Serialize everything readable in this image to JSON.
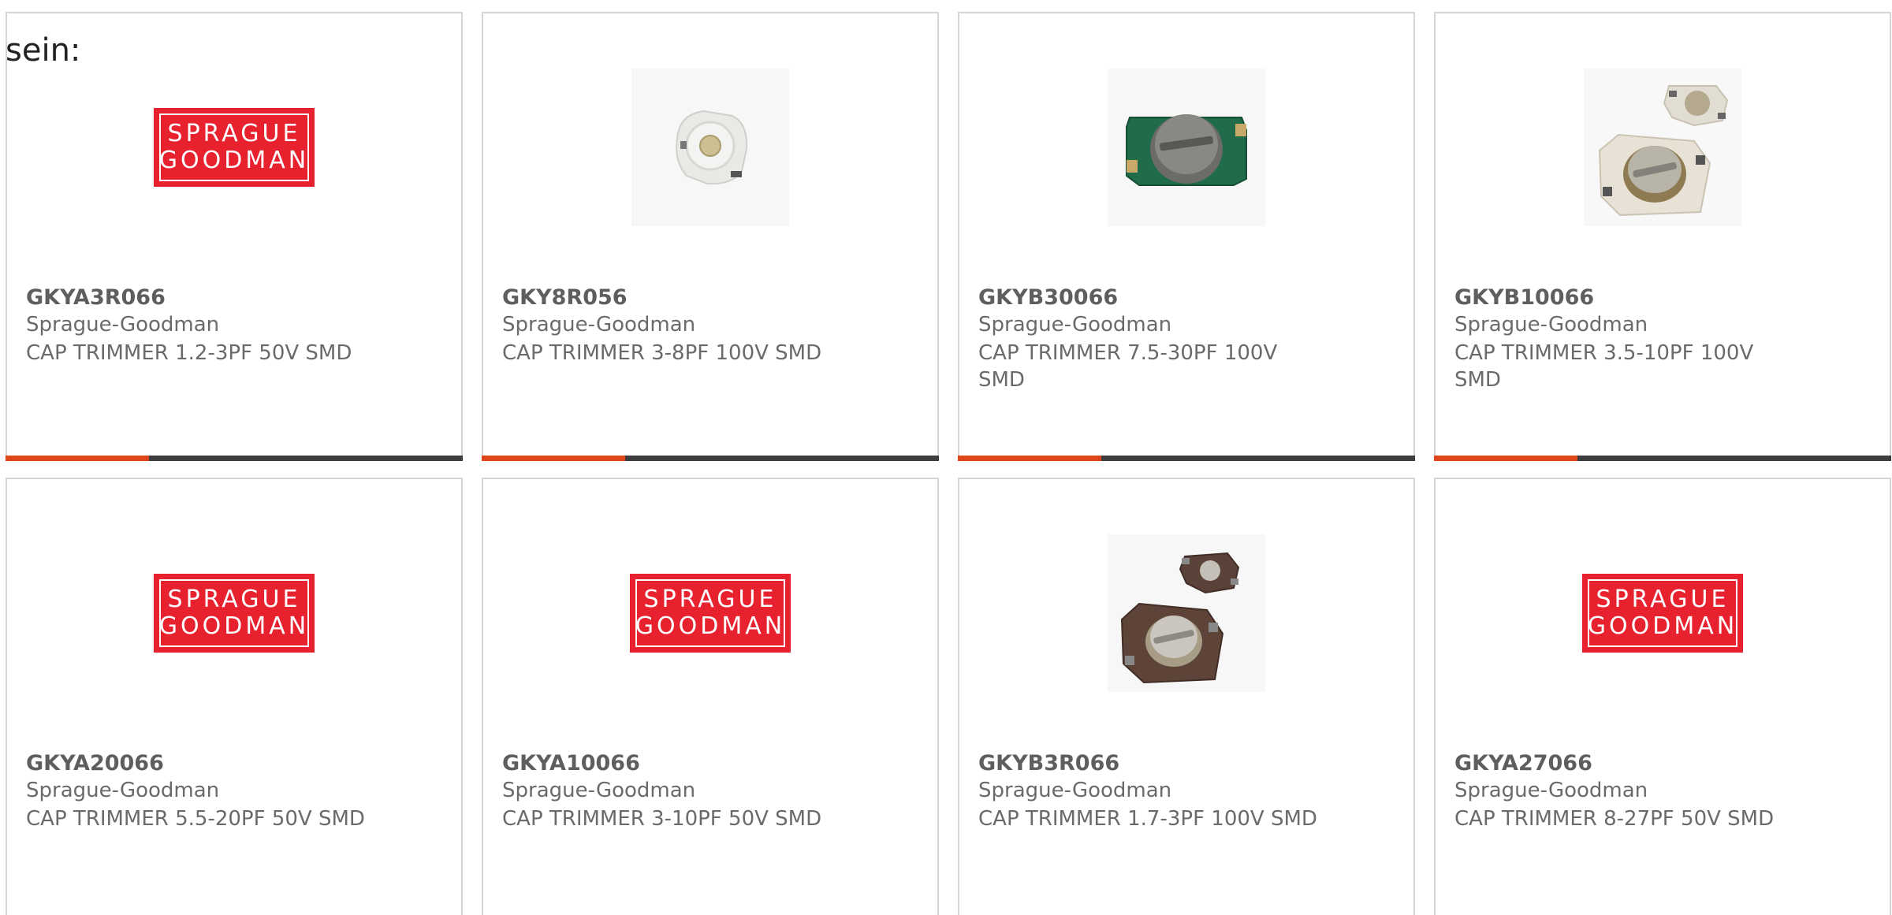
{
  "intro_text": "sein:",
  "logo_lines": [
    "SPRAGUE",
    "GOODMAN"
  ],
  "accent_color": "#e0461c",
  "products": [
    {
      "part": "GKYA3R066",
      "manufacturer": "Sprague-Goodman",
      "description": "CAP TRIMMER 1.2-3PF 50V SMD",
      "image": "sprague-goodman-logo"
    },
    {
      "part": "GKY8R056",
      "manufacturer": "Sprague-Goodman",
      "description": "CAP TRIMMER 3-8PF 100V SMD",
      "image": "white-trimmer-photo"
    },
    {
      "part": "GKYB30066",
      "manufacturer": "Sprague-Goodman",
      "description": "CAP TRIMMER 7.5-30PF 100V SMD",
      "image": "green-trimmer-photo"
    },
    {
      "part": "GKYB10066",
      "manufacturer": "Sprague-Goodman",
      "description": "CAP TRIMMER 3.5-10PF 100V SMD",
      "image": "beige-trimmer-pair-photo"
    },
    {
      "part": "GKYA20066",
      "manufacturer": "Sprague-Goodman",
      "description": "CAP TRIMMER 5.5-20PF 50V SMD",
      "image": "sprague-goodman-logo"
    },
    {
      "part": "GKYA10066",
      "manufacturer": "Sprague-Goodman",
      "description": "CAP TRIMMER 3-10PF 50V SMD",
      "image": "sprague-goodman-logo"
    },
    {
      "part": "GKYB3R066",
      "manufacturer": "Sprague-Goodman",
      "description": "CAP TRIMMER 1.7-3PF 100V SMD",
      "image": "brown-trimmer-pair-photo"
    },
    {
      "part": "GKYA27066",
      "manufacturer": "Sprague-Goodman",
      "description": "CAP TRIMMER 8-27PF 50V SMD",
      "image": "sprague-goodman-logo"
    }
  ]
}
